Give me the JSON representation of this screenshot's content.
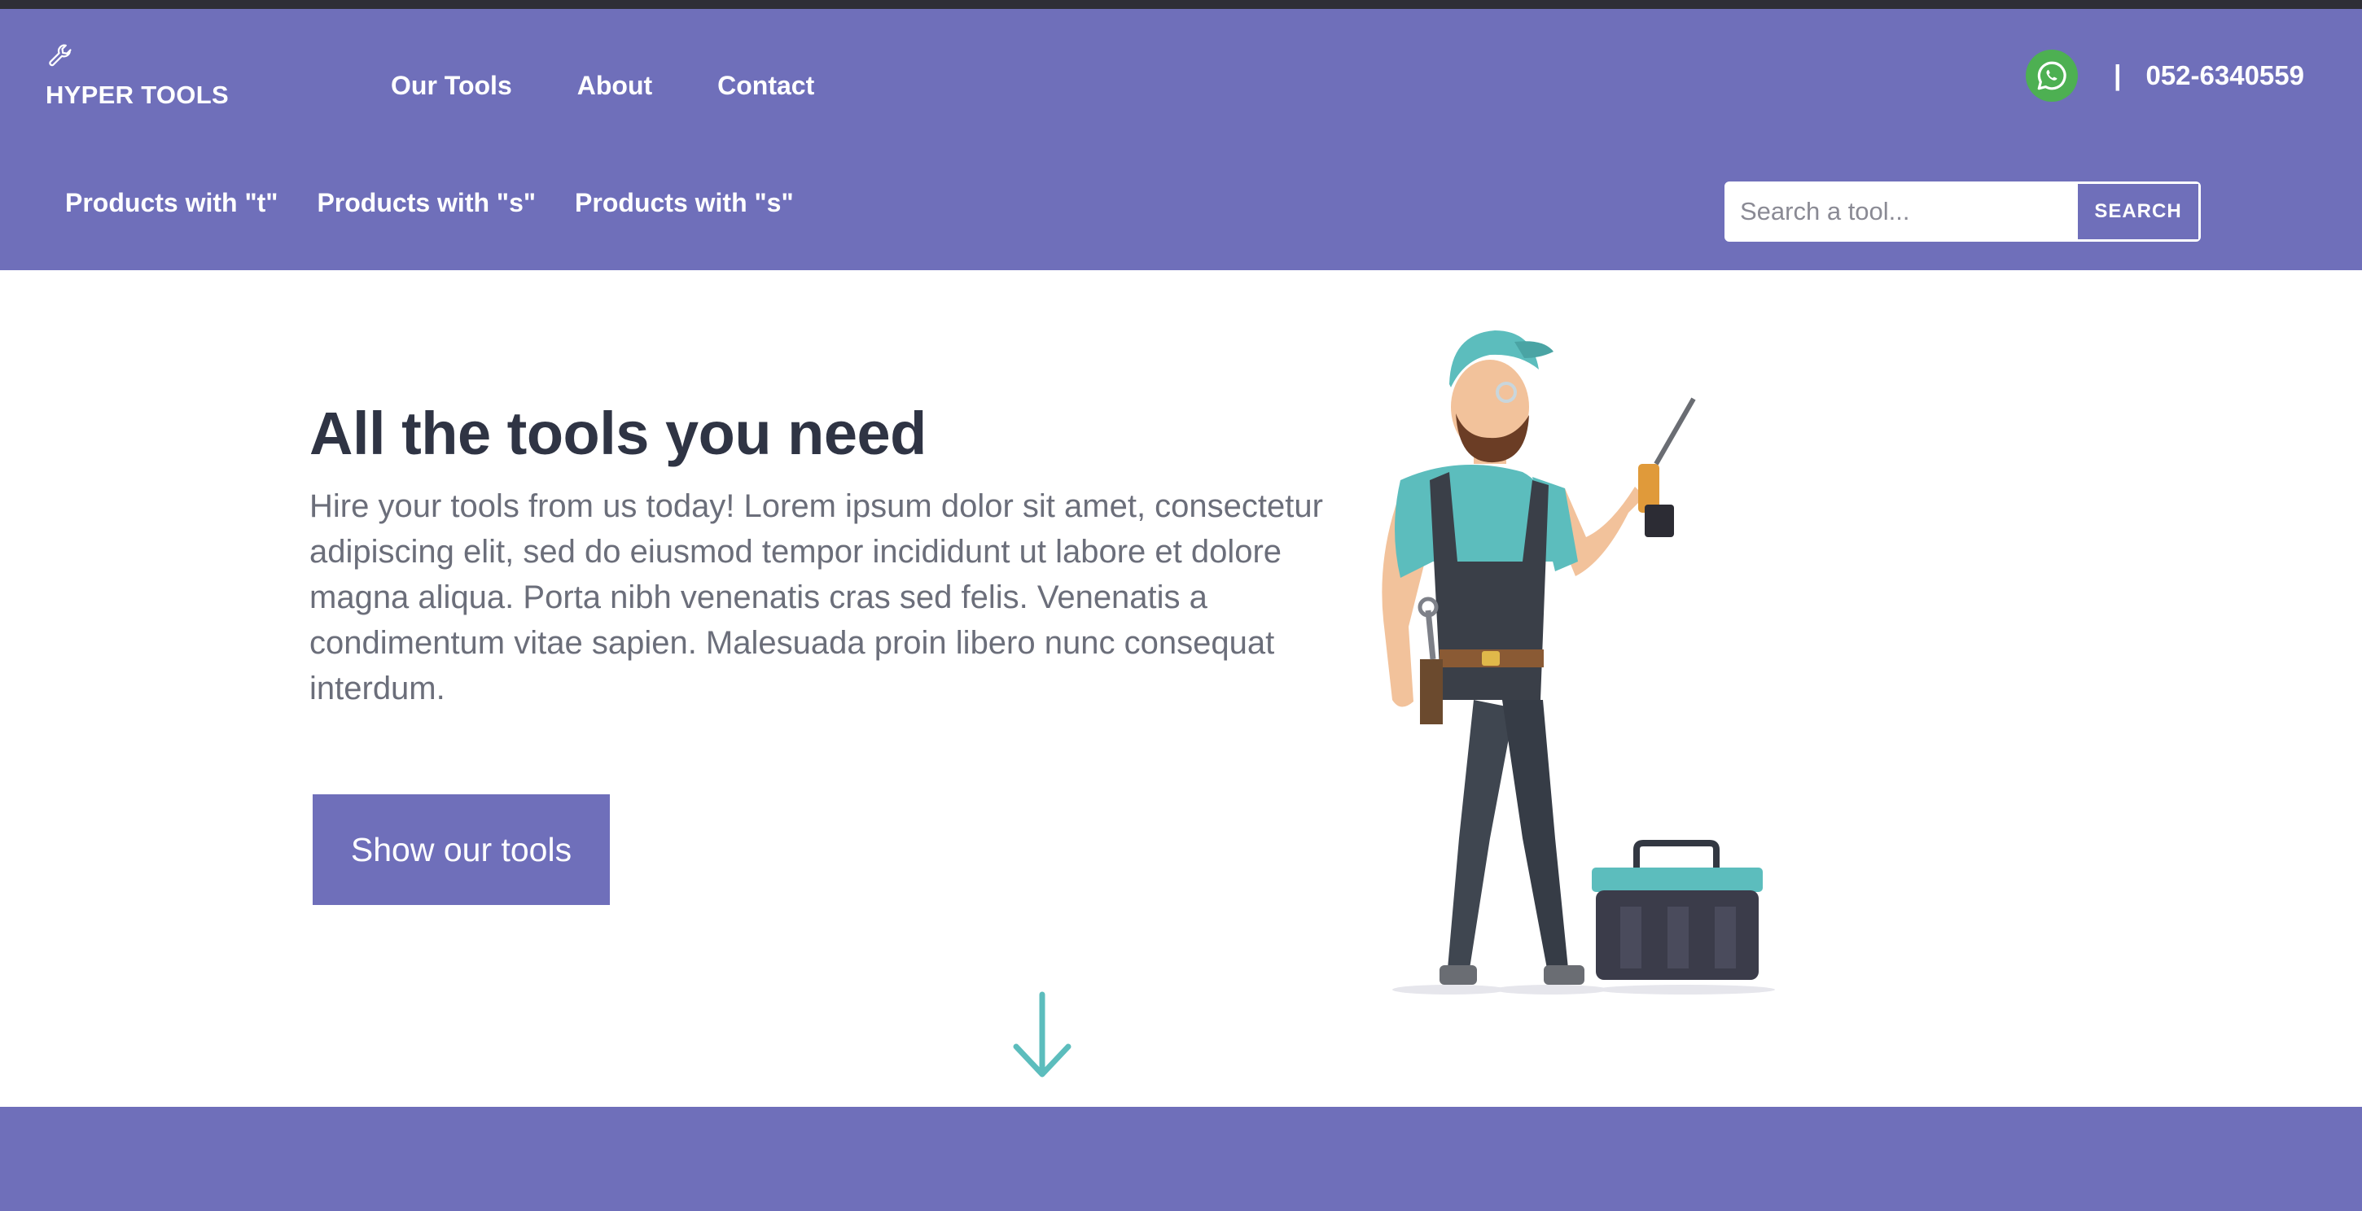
{
  "brand": {
    "name": "HYPER TOOLS",
    "icon": "wrench-icon"
  },
  "nav": {
    "items": [
      "Our Tools",
      "About",
      "Contact"
    ]
  },
  "contact": {
    "icon": "whatsapp-icon",
    "separator": "|",
    "phone": "052-6340559"
  },
  "subnav": {
    "items": [
      "Products with \"t\"",
      "Products with \"s\"",
      "Products with \"s\""
    ]
  },
  "search": {
    "placeholder": "Search a tool...",
    "value": "",
    "button_label": "SEARCH"
  },
  "hero": {
    "title": "All the tools you need",
    "text": "Hire your tools from us today! Lorem ipsum dolor sit amet, consectetur adipiscing elit, sed do eiusmod tempor incididunt ut labore et dolore magna aliqua. Porta nibh venenatis cras sed felis. Venenatis a condimentum vitae sapien. Malesuada proin libero nunc consequat interdum.",
    "cta_label": "Show our tools",
    "illustration": "handyman-with-drill-illustration"
  },
  "scroll_icon": "arrow-down-icon",
  "colors": {
    "primary": "#6f6fba",
    "heading": "#2f3444",
    "body_text": "#6b6e7a",
    "accent": "#5cbdbd",
    "whatsapp": "#4db052"
  }
}
